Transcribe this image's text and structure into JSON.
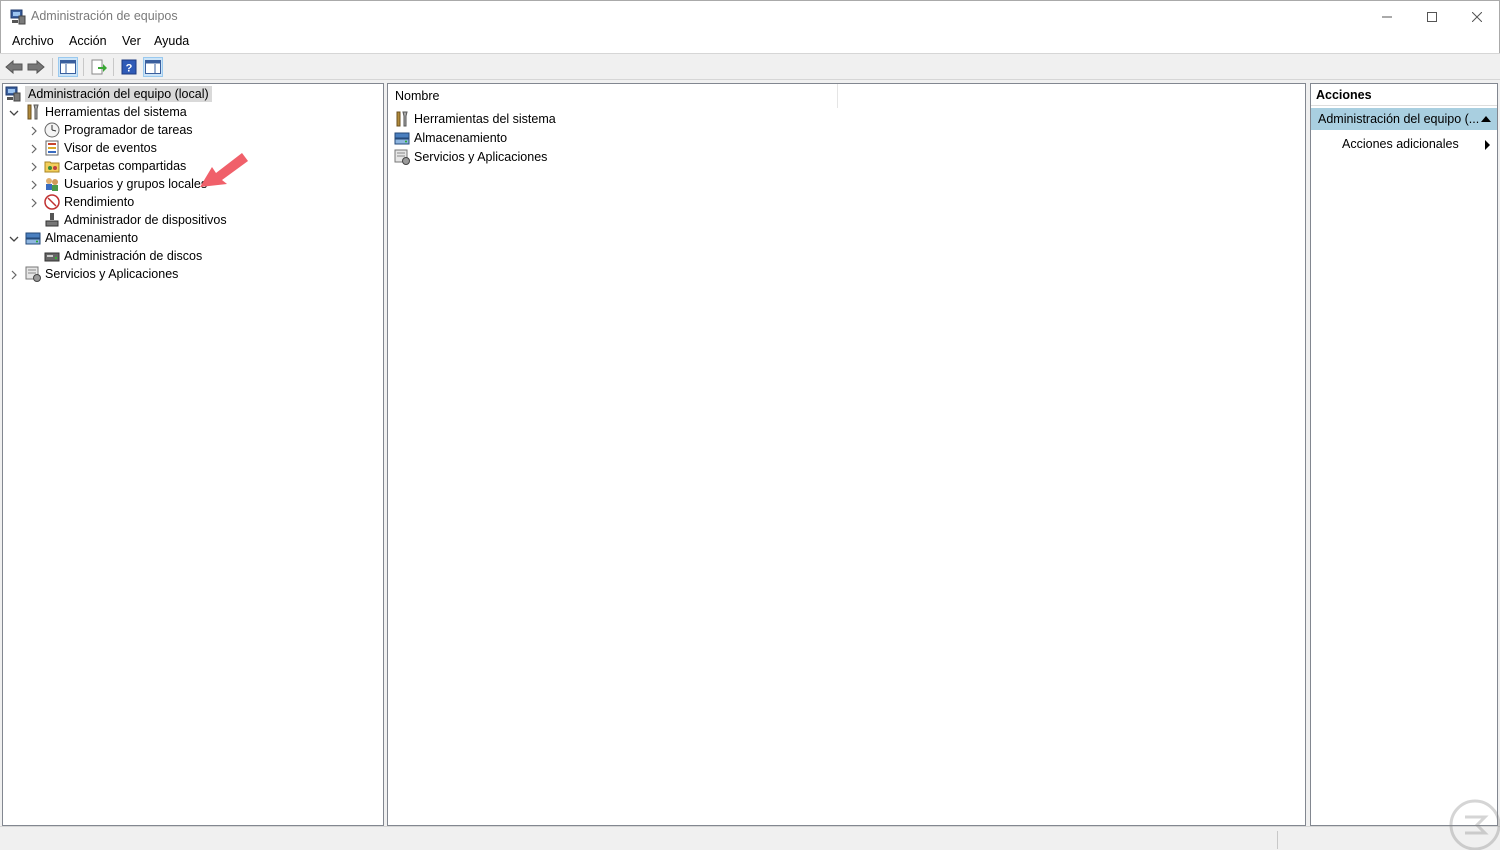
{
  "window": {
    "title": "Administración de equipos",
    "icon": "computer-management-icon"
  },
  "menu": [
    "Archivo",
    "Acción",
    "Ver",
    "Ayuda"
  ],
  "toolbar": {
    "buttons": [
      "back-arrow-icon",
      "forward-arrow-icon",
      "show-hide-console-tree-icon",
      "export-list-icon",
      "help-icon",
      "show-hide-action-pane-icon"
    ]
  },
  "tree": {
    "root": "Administración del equipo (local)",
    "items": [
      {
        "label": "Herramientas del sistema",
        "icon": "system-tools-icon",
        "expanded": true
      },
      {
        "label": "Programador de tareas",
        "icon": "clock-icon"
      },
      {
        "label": "Visor de eventos",
        "icon": "event-viewer-icon"
      },
      {
        "label": "Carpetas compartidas",
        "icon": "shared-folders-icon"
      },
      {
        "label": "Usuarios y grupos locales",
        "icon": "users-groups-icon"
      },
      {
        "label": "Rendimiento",
        "icon": "performance-icon"
      },
      {
        "label": "Administrador de dispositivos",
        "icon": "device-manager-icon"
      },
      {
        "label": "Almacenamiento",
        "icon": "storage-icon",
        "expanded": true
      },
      {
        "label": "Administración de discos",
        "icon": "disk-management-icon"
      },
      {
        "label": "Servicios y Aplicaciones",
        "icon": "services-apps-icon"
      }
    ]
  },
  "list": {
    "column_header": "Nombre",
    "items": [
      "Herramientas del sistema",
      "Almacenamiento",
      "Servicios y Aplicaciones"
    ]
  },
  "actions": {
    "header": "Acciones",
    "group": "Administración del equipo (...",
    "items": [
      "Acciones adicionales"
    ]
  },
  "annotation": {
    "arrow_color": "#f0606a"
  },
  "colors": {
    "selection": "#d9d9d9",
    "actions_group_bg": "#a9cfe0"
  }
}
